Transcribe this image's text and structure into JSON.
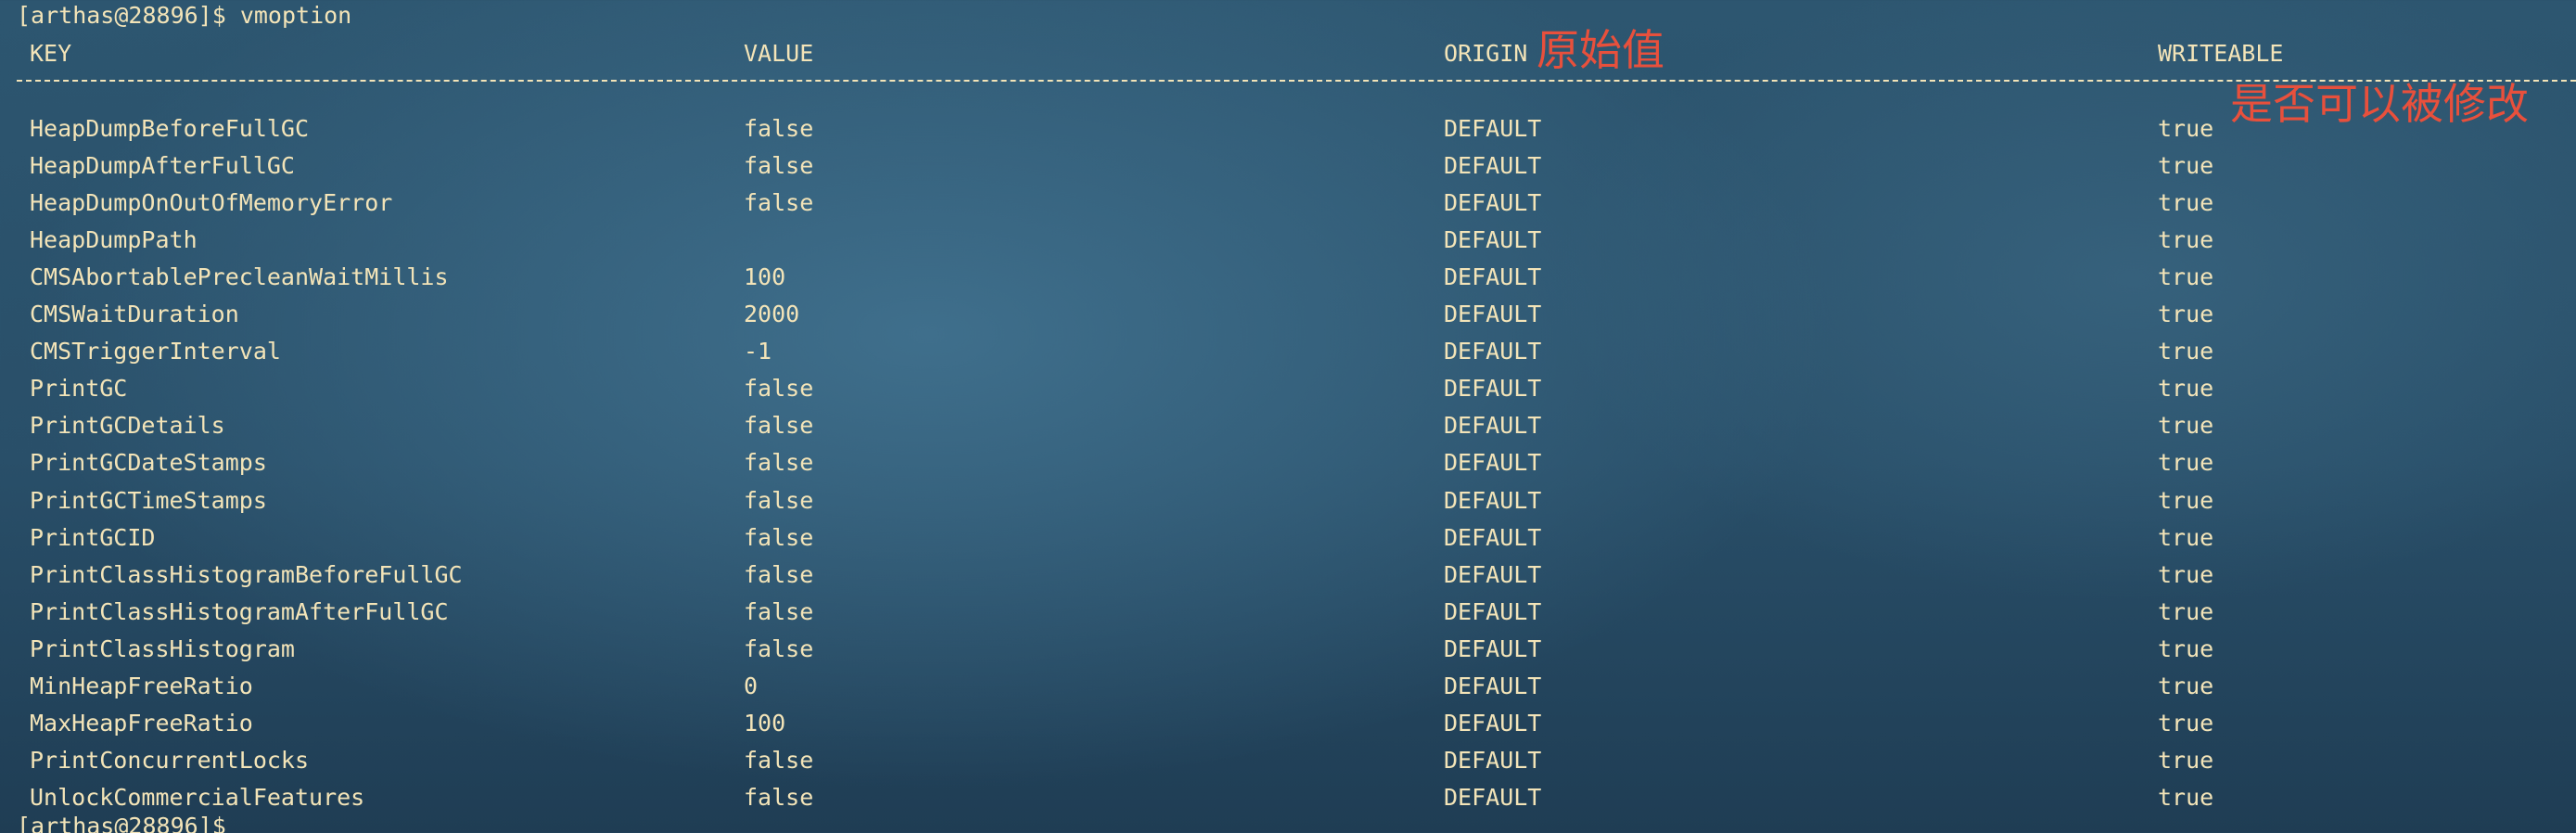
{
  "terminal": {
    "prompt_command": "[arthas@28896]$ vmoption",
    "prompt_bottom": "[arthas@28896]$"
  },
  "table": {
    "columns": [
      "KEY",
      "VALUE",
      "ORIGIN",
      "WRITEABLE"
    ],
    "rows": [
      {
        "key": "HeapDumpBeforeFullGC",
        "value": "false",
        "origin": "DEFAULT",
        "writeable": "true"
      },
      {
        "key": "HeapDumpAfterFullGC",
        "value": "false",
        "origin": "DEFAULT",
        "writeable": "true"
      },
      {
        "key": "HeapDumpOnOutOfMemoryError",
        "value": "false",
        "origin": "DEFAULT",
        "writeable": "true"
      },
      {
        "key": "HeapDumpPath",
        "value": "",
        "origin": "DEFAULT",
        "writeable": "true"
      },
      {
        "key": "CMSAbortablePrecleanWaitMillis",
        "value": "100",
        "origin": "DEFAULT",
        "writeable": "true"
      },
      {
        "key": "CMSWaitDuration",
        "value": "2000",
        "origin": "DEFAULT",
        "writeable": "true"
      },
      {
        "key": "CMSTriggerInterval",
        "value": "-1",
        "origin": "DEFAULT",
        "writeable": "true"
      },
      {
        "key": "PrintGC",
        "value": "false",
        "origin": "DEFAULT",
        "writeable": "true"
      },
      {
        "key": "PrintGCDetails",
        "value": "false",
        "origin": "DEFAULT",
        "writeable": "true"
      },
      {
        "key": "PrintGCDateStamps",
        "value": "false",
        "origin": "DEFAULT",
        "writeable": "true"
      },
      {
        "key": "PrintGCTimeStamps",
        "value": "false",
        "origin": "DEFAULT",
        "writeable": "true"
      },
      {
        "key": "PrintGCID",
        "value": "false",
        "origin": "DEFAULT",
        "writeable": "true"
      },
      {
        "key": "PrintClassHistogramBeforeFullGC",
        "value": "false",
        "origin": "DEFAULT",
        "writeable": "true"
      },
      {
        "key": "PrintClassHistogramAfterFullGC",
        "value": "false",
        "origin": "DEFAULT",
        "writeable": "true"
      },
      {
        "key": "PrintClassHistogram",
        "value": "false",
        "origin": "DEFAULT",
        "writeable": "true"
      },
      {
        "key": "MinHeapFreeRatio",
        "value": "0",
        "origin": "DEFAULT",
        "writeable": "true"
      },
      {
        "key": "MaxHeapFreeRatio",
        "value": "100",
        "origin": "DEFAULT",
        "writeable": "true"
      },
      {
        "key": "PrintConcurrentLocks",
        "value": "false",
        "origin": "DEFAULT",
        "writeable": "true"
      },
      {
        "key": "UnlockCommercialFeatures",
        "value": "false",
        "origin": "DEFAULT",
        "writeable": "true"
      }
    ]
  },
  "annotations": {
    "origin_note": "原始值",
    "writeable_note": "是否可以被修改"
  },
  "colors": {
    "terminal_text": "#f3e4b8",
    "annotation_red": "#e8503c",
    "background": "#2d5670"
  }
}
